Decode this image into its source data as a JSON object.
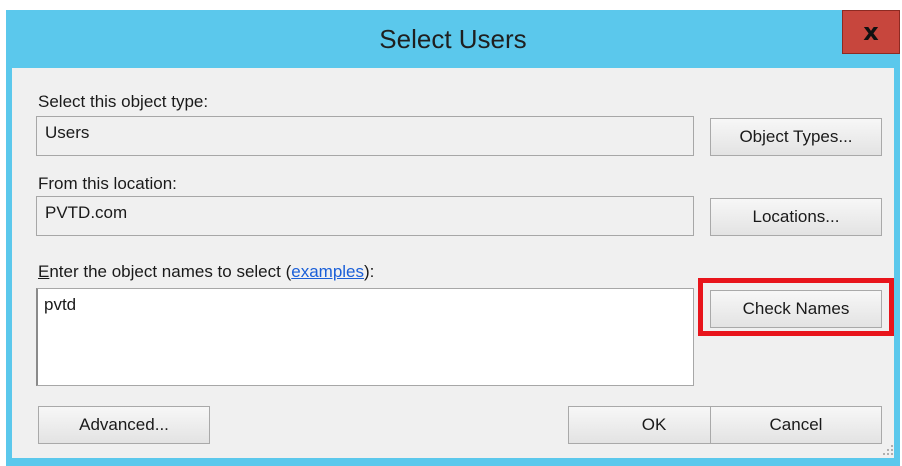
{
  "window": {
    "title": "Select Users",
    "close_glyph": "x",
    "colors": {
      "titlebar": "#5bc8ec",
      "close": "#c7463d",
      "highlight": "#e8141b",
      "link": "#1a5fd8"
    }
  },
  "object_type": {
    "label": "Select this object type:",
    "value": "Users",
    "button": "Object Types..."
  },
  "location": {
    "label": "From this location:",
    "value": "PVTD.com",
    "button": "Locations..."
  },
  "names": {
    "label_prefix_underlined": "E",
    "label_middle": "nter the object names to select (",
    "label_link": "examples",
    "label_suffix": "):",
    "value": "pvtd",
    "check_button": "Check Names"
  },
  "footer": {
    "advanced_button": "Advanced...",
    "ok_button": "OK",
    "cancel_button": "Cancel"
  }
}
